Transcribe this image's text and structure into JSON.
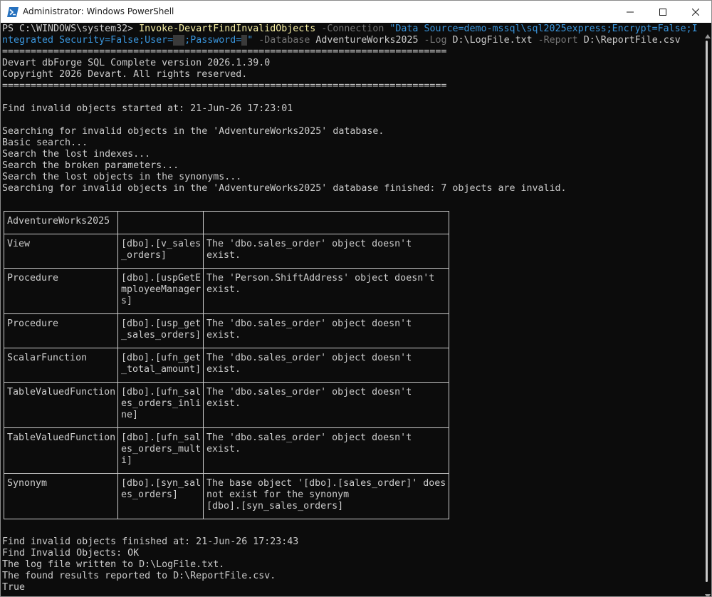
{
  "window": {
    "title": "Administrator: Windows PowerShell"
  },
  "icons": {
    "app": "powershell-icon",
    "minimize": "minimize-icon",
    "maximize": "maximize-icon",
    "close": "close-icon"
  },
  "colors": {
    "background": "#0c0c0c",
    "text": "#cccccc",
    "cmdlet": "#f9f1a5",
    "parameter": "#767676",
    "string": "#3a96dd"
  },
  "prompt": "PS C:\\WINDOWS\\system32> ",
  "command": {
    "cmdlet": "Invoke-DevartFindInvalidObjects",
    "connection_param": "-Connection",
    "connection_value_1": "\"Data Source=demo-mssql\\sql2025express;Encrypt=False;I",
    "connection_value_2": "ntegrated Security=False;User=",
    "connection_value_3": ";Password=",
    "connection_value_4": "\"",
    "database_param": "-Database",
    "database_value": "AdventureWorks2025",
    "log_param": "-Log",
    "log_value": "D:\\LogFile.txt",
    "report_param": "-Report",
    "report_value": "D:\\ReportFile.csv"
  },
  "output_before": "==============================================================================\nDevart dbForge SQL Complete version 2026.1.39.0\nCopyright 2026 Devart. All rights reserved.\n==============================================================================\n\nFind invalid objects started at: 21-Jun-26 17:23:01\n\nSearching for invalid objects in the 'AdventureWorks2025' database.\nBasic search...\nSearch the lost indexes...\nSearch the broken parameters...\nSearch the lost objects in the synonyms...\nSearching for invalid objects in the 'AdventureWorks2025' database finished: 7 objects are invalid.",
  "table": {
    "header": "AdventureWorks2025",
    "rows": [
      {
        "type": "View",
        "object": "[dbo].[v_sales\n_orders]",
        "message": "The 'dbo.sales_order' object doesn't\nexist."
      },
      {
        "type": "Procedure",
        "object": "[dbo].[uspGetE\nmployeeManager\ns]",
        "message": "The 'Person.ShiftAddress' object doesn't\nexist."
      },
      {
        "type": "Procedure",
        "object": "[dbo].[usp_get\n_sales_orders]",
        "message": "The 'dbo.sales_order' object doesn't\nexist."
      },
      {
        "type": "ScalarFunction",
        "object": "[dbo].[ufn_get\n_total_amount]",
        "message": "The 'dbo.sales_order' object doesn't\nexist."
      },
      {
        "type": "TableValuedFunction",
        "object": "[dbo].[ufn_sal\nes_orders_inli\nne]",
        "message": "The 'dbo.sales_order' object doesn't\nexist."
      },
      {
        "type": "TableValuedFunction",
        "object": "[dbo].[ufn_sal\nes_orders_mult\ni]",
        "message": "The 'dbo.sales_order' object doesn't\nexist."
      },
      {
        "type": "Synonym",
        "object": "[dbo].[syn_sal\nes_orders]",
        "message": "The base object '[dbo].[sales_order]' does\nnot exist for the synonym\n[dbo].[syn_sales_orders]"
      }
    ]
  },
  "output_after": "Find invalid objects finished at: 21-Jun-26 17:23:43\nFind Invalid Objects: OK\nThe log file written to D:\\LogFile.txt.\nThe found results reported to D:\\ReportFile.csv.\nTrue"
}
